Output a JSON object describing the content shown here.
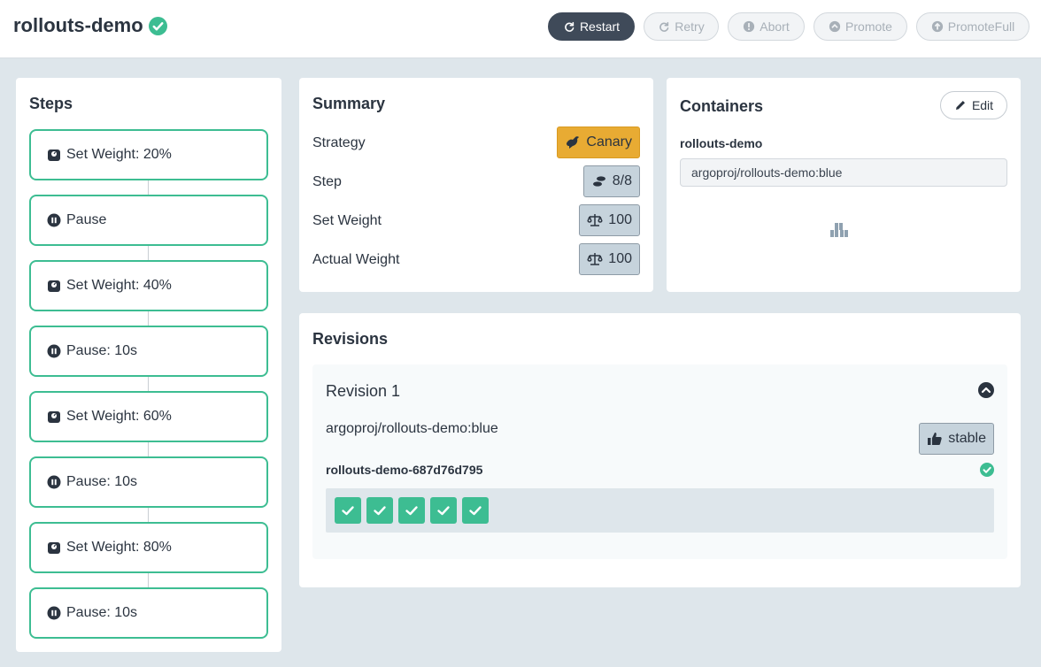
{
  "header": {
    "title": "rollouts-demo",
    "status_icon": "check-circle-icon",
    "buttons": [
      {
        "label": "Restart",
        "icon": "sync-icon",
        "state": "enabled"
      },
      {
        "label": "Retry",
        "icon": "redo-icon",
        "state": "disabled"
      },
      {
        "label": "Abort",
        "icon": "exclamation-circle-icon",
        "state": "disabled"
      },
      {
        "label": "Promote",
        "icon": "chevron-circle-up-icon",
        "state": "disabled"
      },
      {
        "label": "PromoteFull",
        "icon": "arrow-circle-up-icon",
        "state": "disabled"
      }
    ]
  },
  "steps": {
    "title": "Steps",
    "items": [
      {
        "label": "Set Weight: 20%",
        "icon": "weight-icon"
      },
      {
        "label": "Pause",
        "icon": "pause-circle-icon"
      },
      {
        "label": "Set Weight: 40%",
        "icon": "weight-icon"
      },
      {
        "label": "Pause: 10s",
        "icon": "pause-circle-icon"
      },
      {
        "label": "Set Weight: 60%",
        "icon": "weight-icon"
      },
      {
        "label": "Pause: 10s",
        "icon": "pause-circle-icon"
      },
      {
        "label": "Set Weight: 80%",
        "icon": "weight-icon"
      },
      {
        "label": "Pause: 10s",
        "icon": "pause-circle-icon"
      }
    ]
  },
  "summary": {
    "title": "Summary",
    "rows": [
      {
        "label": "Strategy",
        "value": "Canary",
        "icon": "dove-icon"
      },
      {
        "label": "Step",
        "value": "8/8",
        "icon": "shoe-prints-icon"
      },
      {
        "label": "Set Weight",
        "value": "100",
        "icon": "balance-scale-icon"
      },
      {
        "label": "Actual Weight",
        "value": "100",
        "icon": "balance-scale-icon"
      }
    ],
    "strategy_color": "#e8ab33"
  },
  "containers": {
    "title": "Containers",
    "edit_label": "Edit",
    "name": "rollouts-demo",
    "image": "argoproj/rollouts-demo:blue"
  },
  "revisions": {
    "title": "Revisions",
    "items": [
      {
        "title": "Revision 1",
        "image": "argoproj/rollouts-demo:blue",
        "badge": "stable",
        "replicaset": "rollouts-demo-687d76d795",
        "pods": [
          "ok",
          "ok",
          "ok",
          "ok",
          "ok"
        ]
      }
    ]
  },
  "colors": {
    "accent_green": "#3dbd92",
    "header_button_dark": "#3f4a59",
    "page_bg": "#dee6eb"
  }
}
